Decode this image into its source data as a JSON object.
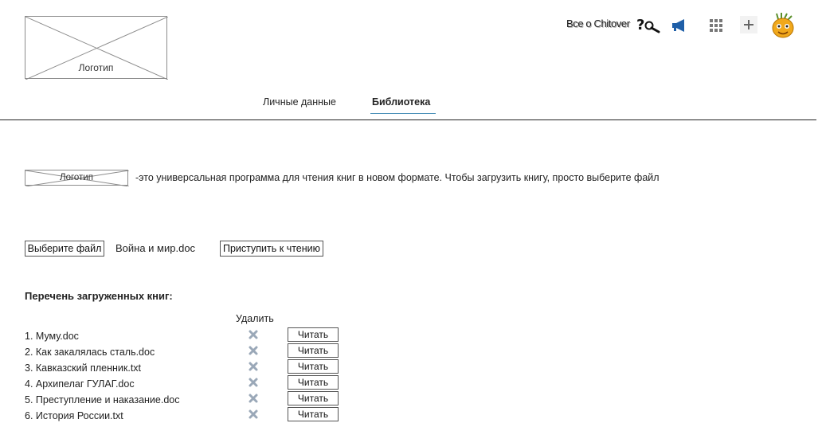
{
  "header": {
    "logo_text": "Логотип",
    "about_link": "Все о Chitover",
    "icons": [
      "help-search-icon",
      "megaphone-icon",
      "apps-grid-icon",
      "plus-icon",
      "avatar-icon"
    ],
    "colors": {
      "megaphone": "#1f5fa8",
      "apps": "#777777",
      "tab_underline": "#4a90b8"
    }
  },
  "tabs": [
    {
      "label": "Личные данные",
      "active": false
    },
    {
      "label": "Библиотека",
      "active": true
    }
  ],
  "intro": {
    "logo_text": "Логотип",
    "text": "-это универсальная программа для чтения книг в новом формате. Чтобы загрузить книгу, просто выберите файл"
  },
  "upload": {
    "choose_label": "Выберите файл",
    "file_name": "Война и мир.doc",
    "start_label": "Приступить к чтению"
  },
  "library": {
    "heading": "Перечень загруженных книг:",
    "delete_header": "Удалить",
    "read_label": "Читать",
    "books": [
      "1. Муму.doc",
      "2. Как закалялась сталь.doc",
      "3. Кавказский пленник.txt",
      "4. Архипелаг ГУЛАГ.doc",
      "5. Преступление и наказание.doc",
      "6. История России.txt"
    ]
  }
}
